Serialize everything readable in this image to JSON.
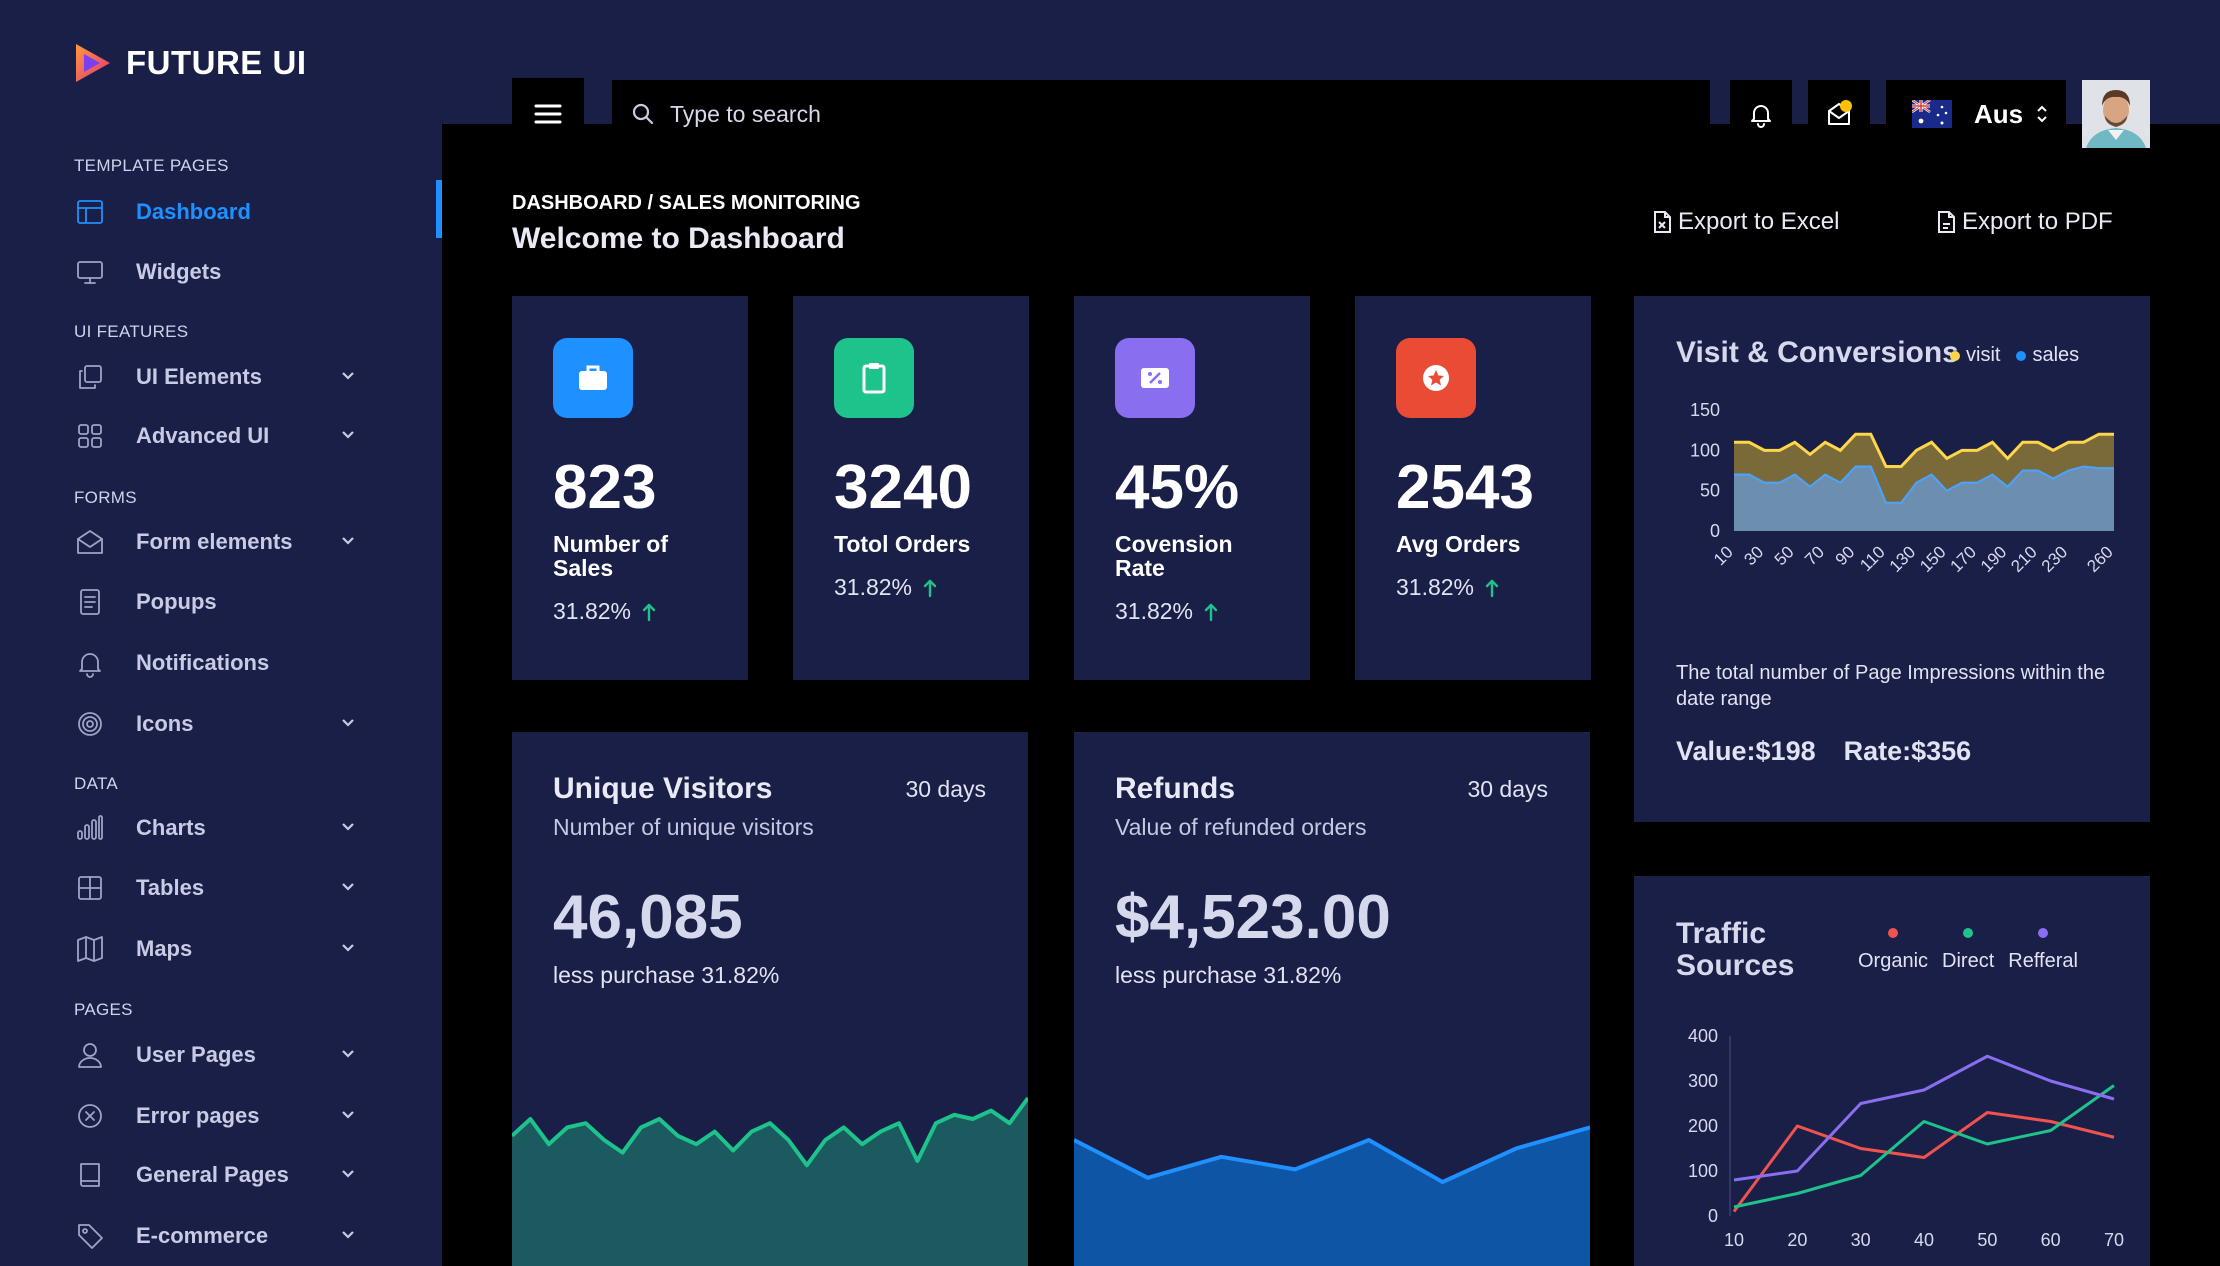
{
  "brand": {
    "name": "FUTURE UI"
  },
  "sidebar": {
    "sections": [
      {
        "label": "TEMPLATE PAGES"
      },
      {
        "label": "UI FEATURES"
      },
      {
        "label": "FORMS"
      },
      {
        "label": "DATA"
      },
      {
        "label": "PAGES"
      }
    ],
    "items": [
      {
        "label": "Dashboard",
        "icon": "layout-icon",
        "active": true
      },
      {
        "label": "Widgets",
        "icon": "monitor-icon"
      },
      {
        "label": "UI Elements",
        "icon": "copy-icon"
      },
      {
        "label": "Advanced UI",
        "icon": "grid-icon"
      },
      {
        "label": "Form elements",
        "icon": "envelope-open-icon"
      },
      {
        "label": "Popups",
        "icon": "document-icon"
      },
      {
        "label": "Notifications",
        "icon": "bell-icon"
      },
      {
        "label": "Icons",
        "icon": "target-icon"
      },
      {
        "label": "Charts",
        "icon": "bar-chart-icon"
      },
      {
        "label": "Tables",
        "icon": "table-icon"
      },
      {
        "label": "Maps",
        "icon": "map-icon"
      },
      {
        "label": "User Pages",
        "icon": "user-icon"
      },
      {
        "label": "Error pages",
        "icon": "error-circle-icon"
      },
      {
        "label": "General Pages",
        "icon": "book-icon"
      },
      {
        "label": "E-commerce",
        "icon": "tag-icon"
      }
    ]
  },
  "topbar": {
    "search_placeholder": "Type to search",
    "language": "Aus"
  },
  "header": {
    "breadcrumb": "DASHBOARD / SALES MONITORING",
    "title": "Welcome to Dashboard",
    "export_excel": "Export to Excel",
    "export_pdf": "Export to PDF"
  },
  "stats": [
    {
      "value": "823",
      "label": "Number of Sales",
      "change": "31.82%",
      "color": "#1e90ff",
      "icon": "briefcase-icon"
    },
    {
      "value": "3240",
      "label": "Totol Orders",
      "change": "31.82%",
      "color": "#1ec28b",
      "icon": "clipboard-icon"
    },
    {
      "value": "45%",
      "label": "Covension Rate",
      "change": "31.82%",
      "color": "#8a6ef0",
      "icon": "percent-ticket-icon"
    },
    {
      "value": "2543",
      "label": "Avg Orders",
      "change": "31.82%",
      "color": "#e94b35",
      "icon": "star-badge-icon"
    }
  ],
  "unique_visitors": {
    "title": "Unique Visitors",
    "period": "30 days",
    "subtitle": "Number of unique visitors",
    "value": "46,085",
    "note": "less purchase 31.82%"
  },
  "refunds": {
    "title": "Refunds",
    "period": "30 days",
    "subtitle": "Value of refunded orders",
    "value": "$4,523.00",
    "note": "less purchase 31.82%"
  },
  "visit_card": {
    "title": "Visit & Conversions",
    "legend": [
      "visit",
      "sales"
    ],
    "description": "The total number of Page Impressions within the date range",
    "value_text": "Value:$198",
    "rate_text": "Rate:$356"
  },
  "traffic_card": {
    "title": "Traffic Sources",
    "legend": [
      "Organic",
      "Direct",
      "Refferal"
    ]
  },
  "colors": {
    "accent": "#1e90ff",
    "panel": "#1a1f47",
    "visit": "#ffd54a",
    "sales": "#1e90ff",
    "organic": "#ef5350",
    "direct": "#1ec28b",
    "referral": "#8a6ef0",
    "positive": "#1ec28b"
  },
  "chart_data": [
    {
      "type": "area",
      "title": "Unique Visitors",
      "series": [
        {
          "values": [
            62,
            70,
            58,
            66,
            68,
            60,
            54,
            66,
            70,
            62,
            58,
            64,
            55,
            64,
            68,
            60,
            48,
            60,
            66,
            58,
            64,
            68,
            50,
            68,
            72,
            70,
            74,
            68,
            80
          ]
        }
      ],
      "ylim": [
        0,
        100
      ]
    },
    {
      "type": "area",
      "title": "Refunds",
      "series": [
        {
          "values": [
            60,
            42,
            52,
            46,
            60,
            40,
            56,
            66
          ]
        }
      ],
      "ylim": [
        0,
        100
      ]
    },
    {
      "type": "area",
      "title": "Visit & Conversions",
      "x": [
        10,
        20,
        30,
        40,
        50,
        60,
        70,
        80,
        90,
        100,
        110,
        120,
        130,
        140,
        150,
        160,
        170,
        180,
        190,
        200,
        210,
        220,
        230,
        240,
        250,
        260
      ],
      "x_tick_labels": [
        "10",
        "30",
        "50",
        "70",
        "90",
        "110",
        "130",
        "150",
        "170",
        "190",
        "210",
        "230",
        "260"
      ],
      "series": [
        {
          "name": "visit",
          "values": [
            110,
            110,
            100,
            100,
            110,
            95,
            110,
            100,
            120,
            120,
            80,
            80,
            100,
            110,
            90,
            100,
            100,
            110,
            90,
            110,
            110,
            100,
            110,
            110,
            120,
            120
          ]
        },
        {
          "name": "sales",
          "values": [
            70,
            70,
            60,
            60,
            70,
            55,
            70,
            60,
            80,
            80,
            35,
            35,
            60,
            70,
            50,
            60,
            60,
            70,
            55,
            75,
            75,
            65,
            75,
            80,
            78,
            78
          ]
        }
      ],
      "yticks": [
        0,
        50,
        100,
        150
      ],
      "ylim": [
        0,
        150
      ]
    },
    {
      "type": "line",
      "title": "Traffic Sources",
      "x": [
        10,
        20,
        30,
        40,
        50,
        60,
        70
      ],
      "series": [
        {
          "name": "Organic",
          "values": [
            10,
            200,
            150,
            130,
            230,
            210,
            175
          ]
        },
        {
          "name": "Direct",
          "values": [
            20,
            50,
            90,
            210,
            160,
            190,
            290
          ]
        },
        {
          "name": "Refferal",
          "values": [
            80,
            100,
            250,
            280,
            355,
            300,
            260
          ]
        }
      ],
      "yticks": [
        0,
        100,
        200,
        300,
        400
      ],
      "ylim": [
        0,
        400
      ],
      "xlim": [
        10,
        70
      ]
    }
  ]
}
